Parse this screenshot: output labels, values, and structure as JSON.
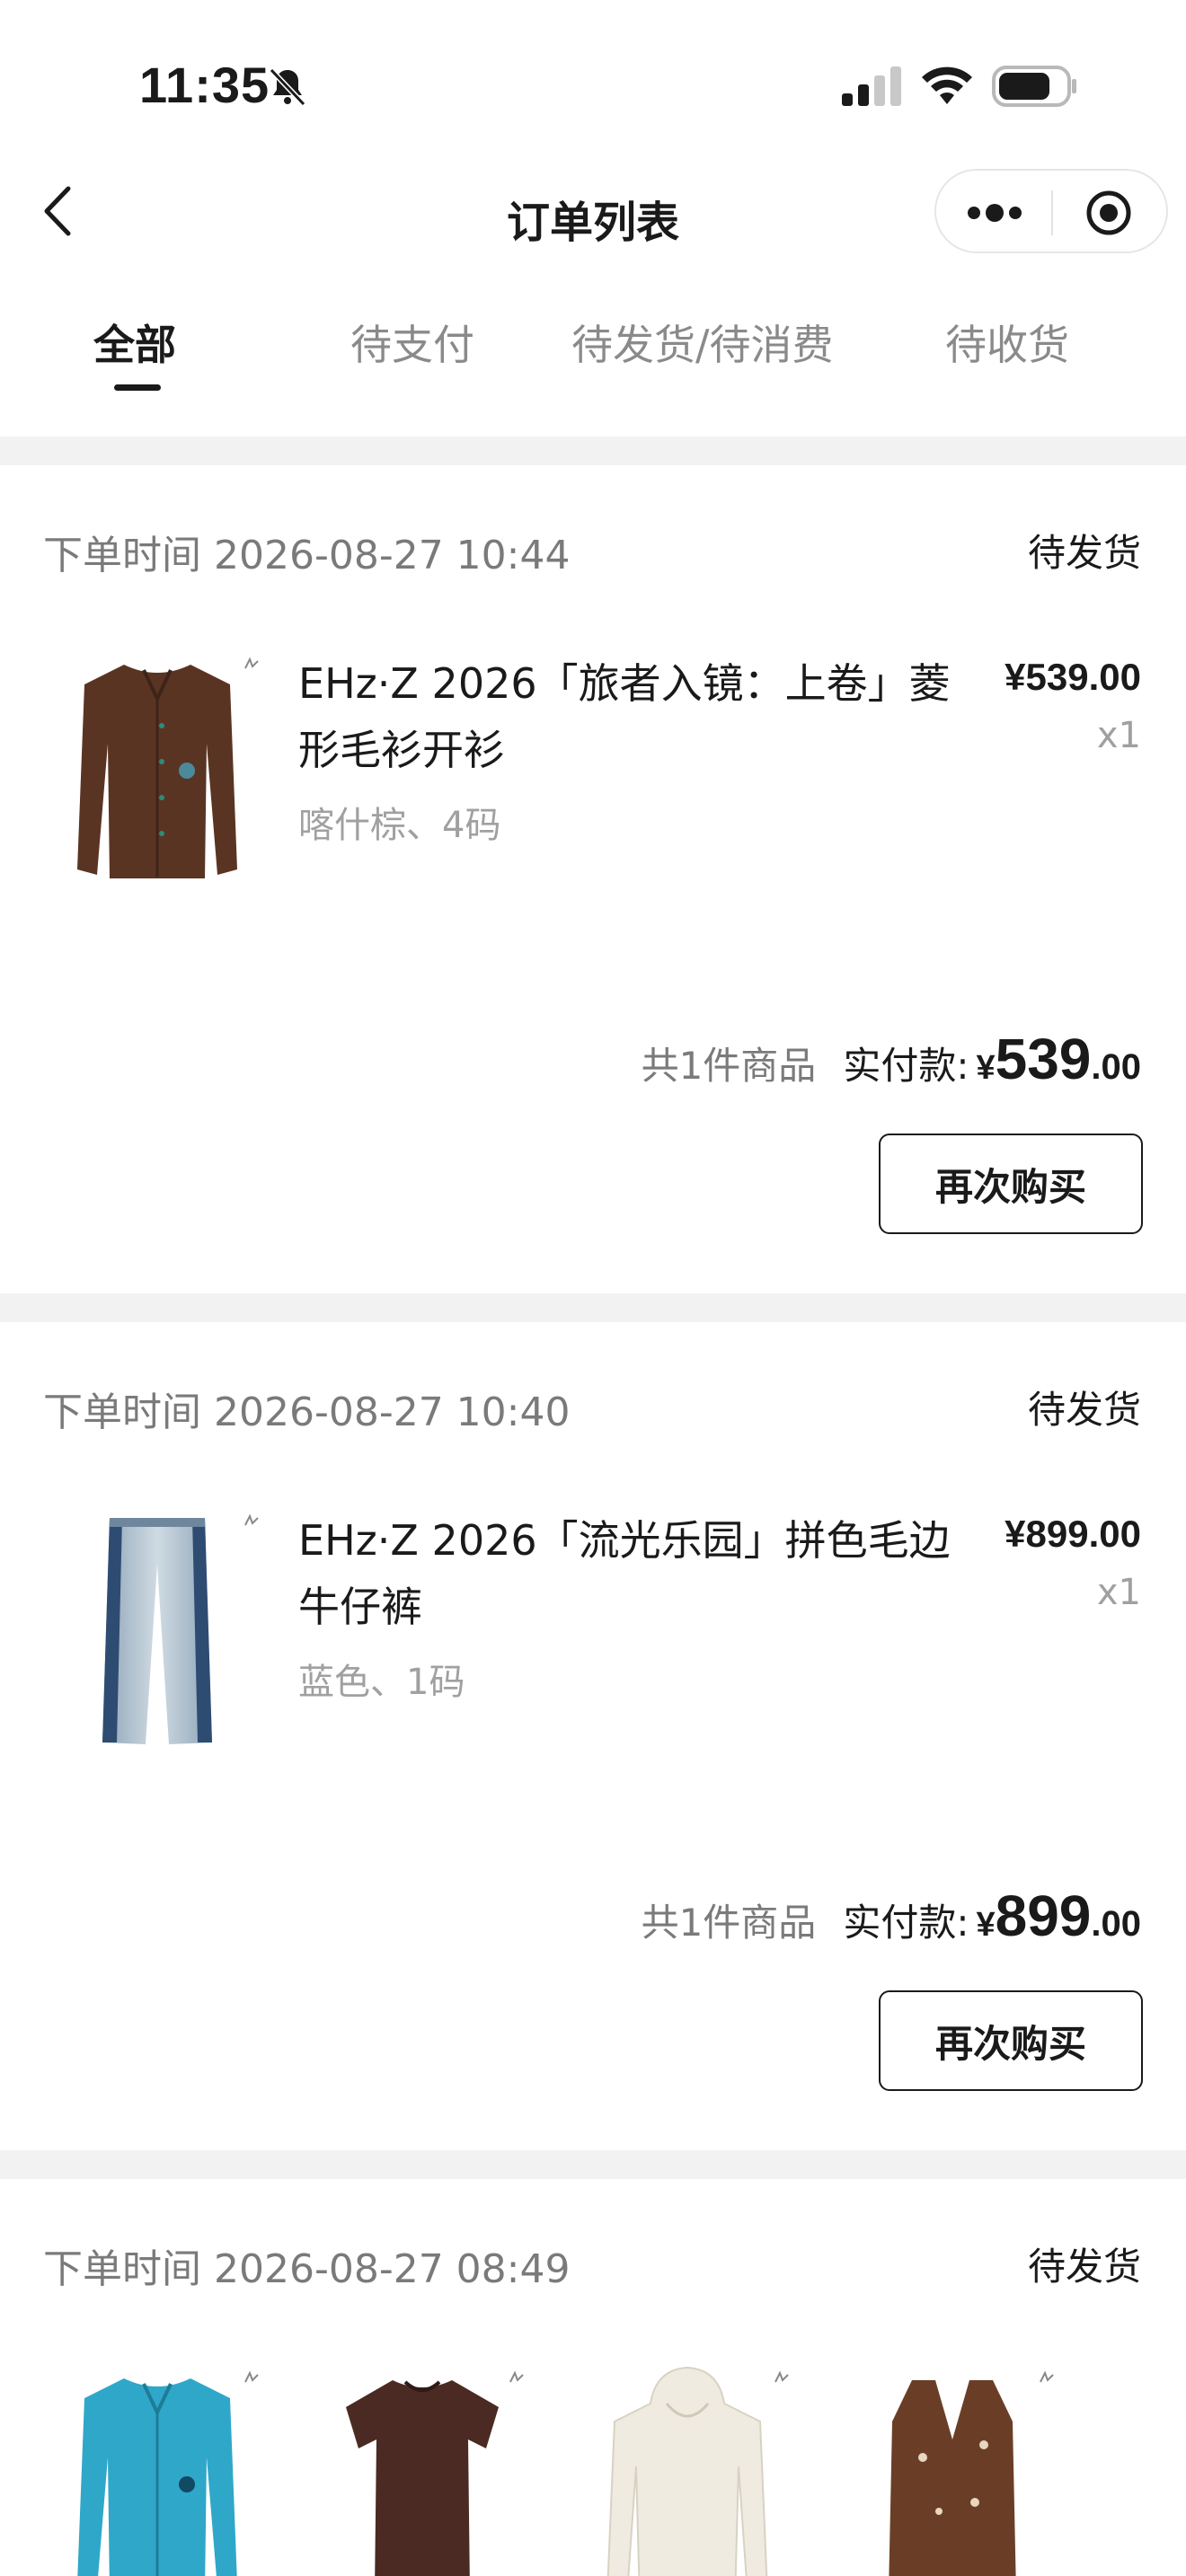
{
  "status_bar": {
    "time": "11:35"
  },
  "nav": {
    "title": "订单列表"
  },
  "tabs": [
    {
      "label": "全部"
    },
    {
      "label": "待支付"
    },
    {
      "label": "待发货/待消费"
    },
    {
      "label": "待收货"
    }
  ],
  "orders": [
    {
      "time_text": "下单时间 2026-08-27 10:44",
      "status": "待发货",
      "item_title": "EHz·Z 2026「旅者入镜：上卷」菱形毛衫开衫",
      "item_spec": "喀什棕、4码",
      "item_price": "¥539.00",
      "item_qty": "x1",
      "count_text": "共1件商品",
      "paid_label": "实付款:",
      "paid_yen": "¥",
      "paid_int": "539",
      "paid_dec": ".00",
      "button": "再次购买"
    },
    {
      "time_text": "下单时间 2026-08-27 10:40",
      "status": "待发货",
      "item_title": "EHz·Z 2026「流光乐园」拼色毛边牛仔裤",
      "item_spec": "蓝色、1码",
      "item_price": "¥899.00",
      "item_qty": "x1",
      "count_text": "共1件商品",
      "paid_label": "实付款:",
      "paid_yen": "¥",
      "paid_int": "899",
      "paid_dec": ".00",
      "button": "再次购买"
    },
    {
      "time_text": "下单时间 2026-08-27 08:49",
      "status": "待发货"
    }
  ]
}
